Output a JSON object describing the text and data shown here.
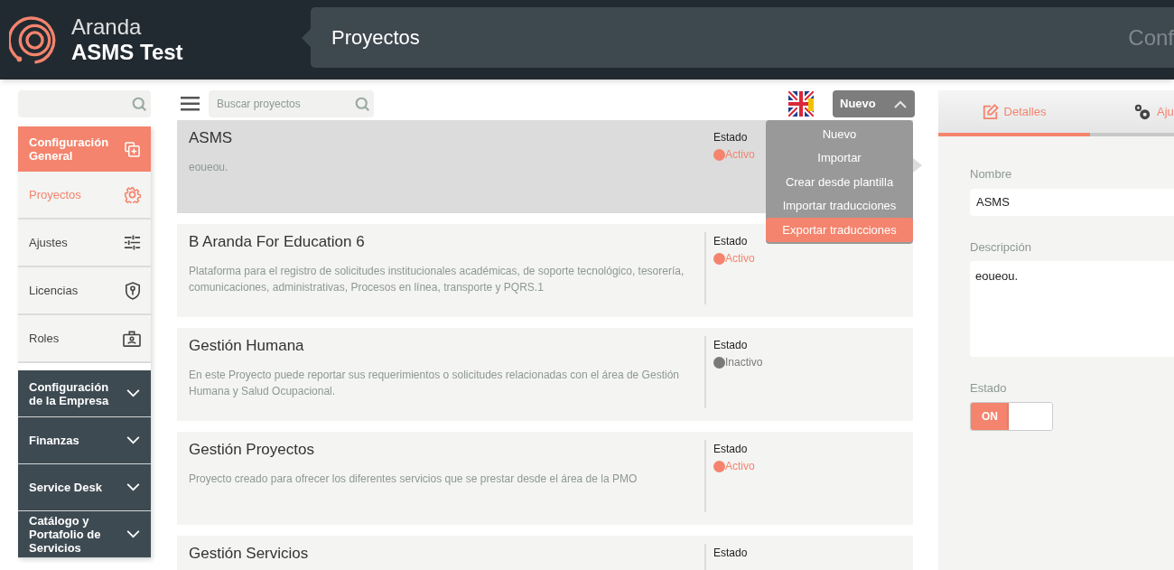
{
  "header": {
    "brand_name": "Aranda",
    "brand_product": "ASMS Test",
    "page_title": "Proyectos",
    "right_title": "Conf"
  },
  "sidebar": {
    "groups": [
      {
        "label": "Configuración General",
        "expanded": true,
        "items": [
          {
            "label": "Proyectos",
            "selected": true
          },
          {
            "label": "Ajustes",
            "selected": false
          },
          {
            "label": "Licencias",
            "selected": false
          },
          {
            "label": "Roles",
            "selected": false
          }
        ]
      },
      {
        "label": "Configuración de la Empresa",
        "expanded": false
      },
      {
        "label": "Finanzas",
        "expanded": false
      },
      {
        "label": "Service Desk",
        "expanded": false
      },
      {
        "label": "Catálogo y Portafolio de Servicios",
        "expanded": false
      }
    ]
  },
  "toolbar": {
    "search_placeholder": "Buscar proyectos",
    "new_button": {
      "label": "Nuevo",
      "expanded": true
    },
    "menu": [
      {
        "label": "Nuevo",
        "selected": false
      },
      {
        "label": "Importar",
        "selected": false
      },
      {
        "label": "Crear desde plantilla",
        "selected": false
      },
      {
        "label": "Importar traducciones",
        "selected": false
      },
      {
        "label": "Exportar traducciones",
        "selected": true
      }
    ]
  },
  "projects": [
    {
      "title": "ASMS",
      "description": "eoueou.",
      "status_label": "Estado",
      "status": "Activo",
      "color": "#f4846d",
      "selected": true
    },
    {
      "title": "B Aranda For Education 6",
      "description": "Plataforma para el registro de solicitudes institucionales académicas, de soporte tecnológico, tesorería, comunicaciones, administrativas, Procesos en línea, transporte y PQRS.1",
      "status_label": "Estado",
      "status": "Activo",
      "color": "#f4846d",
      "selected": false
    },
    {
      "title": "Gestión Humana",
      "description": "En este Proyecto puede reportar sus requerimientos o solicitudes relacionadas con el área de Gestión Humana y Salud Ocupacional.",
      "status_label": "Estado",
      "status": "Inactivo",
      "color": "#7a7a7a",
      "selected": false
    },
    {
      "title": "Gestión Proyectos",
      "description": "Proyecto creado para ofrecer los diferentes servicios que se prestar desde el área de la PMO",
      "status_label": "Estado",
      "status": "Activo",
      "color": "#f4846d",
      "selected": false
    },
    {
      "title": "Gestión Servicios",
      "status_label": "Estado",
      "selected": false
    }
  ],
  "details": {
    "tabs": [
      {
        "label": "Detalles",
        "selected": true
      },
      {
        "label": "Aju",
        "selected": false
      }
    ],
    "name_label": "Nombre",
    "name_value": "ASMS",
    "description_label": "Descripción",
    "description_value": "eoueou.",
    "status_label": "Estado",
    "status_toggle": {
      "on": true,
      "text": "ON"
    }
  }
}
